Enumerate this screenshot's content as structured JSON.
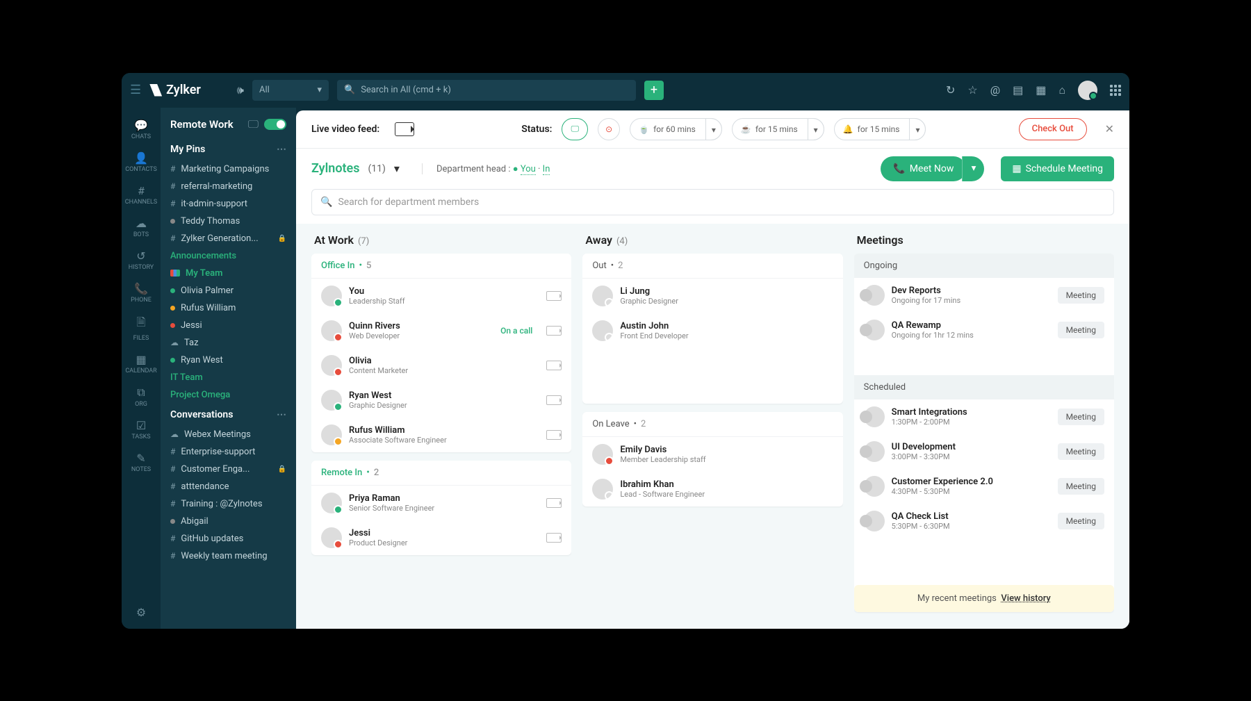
{
  "brand": "Zylker",
  "search_scope": "All",
  "search_placeholder": "Search in All (cmd + k)",
  "rail": [
    "CHATS",
    "CONTACTS",
    "CHANNELS",
    "BOTS",
    "HISTORY",
    "PHONE",
    "FILES",
    "CALENDAR",
    "ORG",
    "TASKS",
    "NOTES"
  ],
  "side": {
    "header": "Remote Work",
    "pins_title": "My Pins",
    "pins": [
      {
        "icon": "hash",
        "label": "Marketing Campaigns"
      },
      {
        "icon": "hash",
        "label": "referral-marketing"
      },
      {
        "icon": "hash",
        "label": "it-admin-support"
      },
      {
        "icon": "dot-grey",
        "label": "Teddy Thomas"
      },
      {
        "icon": "hash",
        "label": "Zylker Generation...",
        "lock": true
      }
    ],
    "announcements": "Announcements",
    "myteam_label": "My Team",
    "myteam": [
      {
        "dot": "dot-green",
        "label": "Olivia Palmer"
      },
      {
        "dot": "dot-yellow",
        "label": "Rufus William"
      },
      {
        "dot": "dot-red",
        "label": "Jessi"
      },
      {
        "icon": "cloud",
        "label": "Taz"
      },
      {
        "dot": "dot-green",
        "label": "Ryan West"
      }
    ],
    "itteam": "IT Team",
    "project": "Project Omega",
    "conv_title": "Conversations",
    "convs": [
      {
        "icon": "cloud",
        "label": "Webex Meetings"
      },
      {
        "icon": "hash",
        "label": "Enterprise-support"
      },
      {
        "icon": "hash",
        "label": "Customer Enga...",
        "lock": true
      },
      {
        "icon": "hash",
        "label": "atttendance"
      },
      {
        "icon": "hash",
        "label": "Training : @Zylnotes"
      },
      {
        "icon": "dot-grey",
        "label": "Abigail"
      },
      {
        "icon": "hash",
        "label": "GitHub updates"
      },
      {
        "icon": "hash",
        "label": "Weekly team meeting"
      }
    ]
  },
  "status": {
    "feed_label": "Live video feed:",
    "status_label": "Status:",
    "opts": [
      {
        "txt": "for 60 mins",
        "color": "#f5a623"
      },
      {
        "txt": "for 15 mins",
        "color": "#f5a623"
      },
      {
        "txt": "for 15 mins",
        "color": "#e74c8c"
      }
    ],
    "checkout": "Check Out"
  },
  "dept": {
    "name": "Zylnotes",
    "count": "(11)",
    "head_label": "Department head :",
    "you": "You",
    "in": "In",
    "meet_now": "Meet Now",
    "schedule": "Schedule Meeting",
    "search_ph": "Search for department members"
  },
  "cols": {
    "atwork": {
      "title": "At Work",
      "count": "(7)"
    },
    "office_in": {
      "title": "Office In",
      "count": "5",
      "people": [
        {
          "nm": "You",
          "rl": "Leadership Staff",
          "st": "green"
        },
        {
          "nm": "Quinn Rivers",
          "rl": "Web Developer",
          "st": "red",
          "oncall": "On a call"
        },
        {
          "nm": "Olivia",
          "rl": "Content Marketer",
          "st": "red"
        },
        {
          "nm": "Ryan West",
          "rl": "Graphic Designer",
          "st": "green"
        },
        {
          "nm": "Rufus William",
          "rl": "Associate Software Engineer",
          "st": "yellow"
        }
      ]
    },
    "remote_in": {
      "title": "Remote In",
      "count": "2",
      "people": [
        {
          "nm": "Priya Raman",
          "rl": "Senior Software Engineer",
          "st": "green"
        },
        {
          "nm": "Jessi",
          "rl": "Product Designer",
          "st": "red"
        }
      ]
    },
    "away": {
      "title": "Away",
      "count": "(4)"
    },
    "out": {
      "title": "Out",
      "count": "2",
      "people": [
        {
          "nm": "Li Jung",
          "rl": "Graphic Designer"
        },
        {
          "nm": "Austin John",
          "rl": "Front End Developer"
        }
      ]
    },
    "onleave": {
      "title": "On Leave",
      "count": "2",
      "people": [
        {
          "nm": "Emily Davis",
          "rl": "Member Leadership staff",
          "st": "red"
        },
        {
          "nm": "Ibrahim Khan",
          "rl": "Lead - Software Engineer"
        }
      ]
    },
    "meetings": {
      "title": "Meetings"
    },
    "ongoing": {
      "title": "Ongoing",
      "items": [
        {
          "nm": "Dev Reports",
          "tm": "Ongoing for 17 mins"
        },
        {
          "nm": "QA Rewamp",
          "tm": "Ongoing for 1hr 12 mins"
        }
      ]
    },
    "scheduled": {
      "title": "Scheduled",
      "items": [
        {
          "nm": "Smart Integrations",
          "tm": "1:30PM - 2:00PM"
        },
        {
          "nm": "UI Development",
          "tm": "3:00PM - 3:30PM"
        },
        {
          "nm": "Customer Experience 2.0",
          "tm": "4:30PM - 5:30PM"
        },
        {
          "nm": "QA Check List",
          "tm": "5:30PM - 6:30PM"
        }
      ]
    },
    "meeting_badge": "Meeting",
    "footer_txt": "My recent meetings",
    "footer_link": "View history"
  }
}
